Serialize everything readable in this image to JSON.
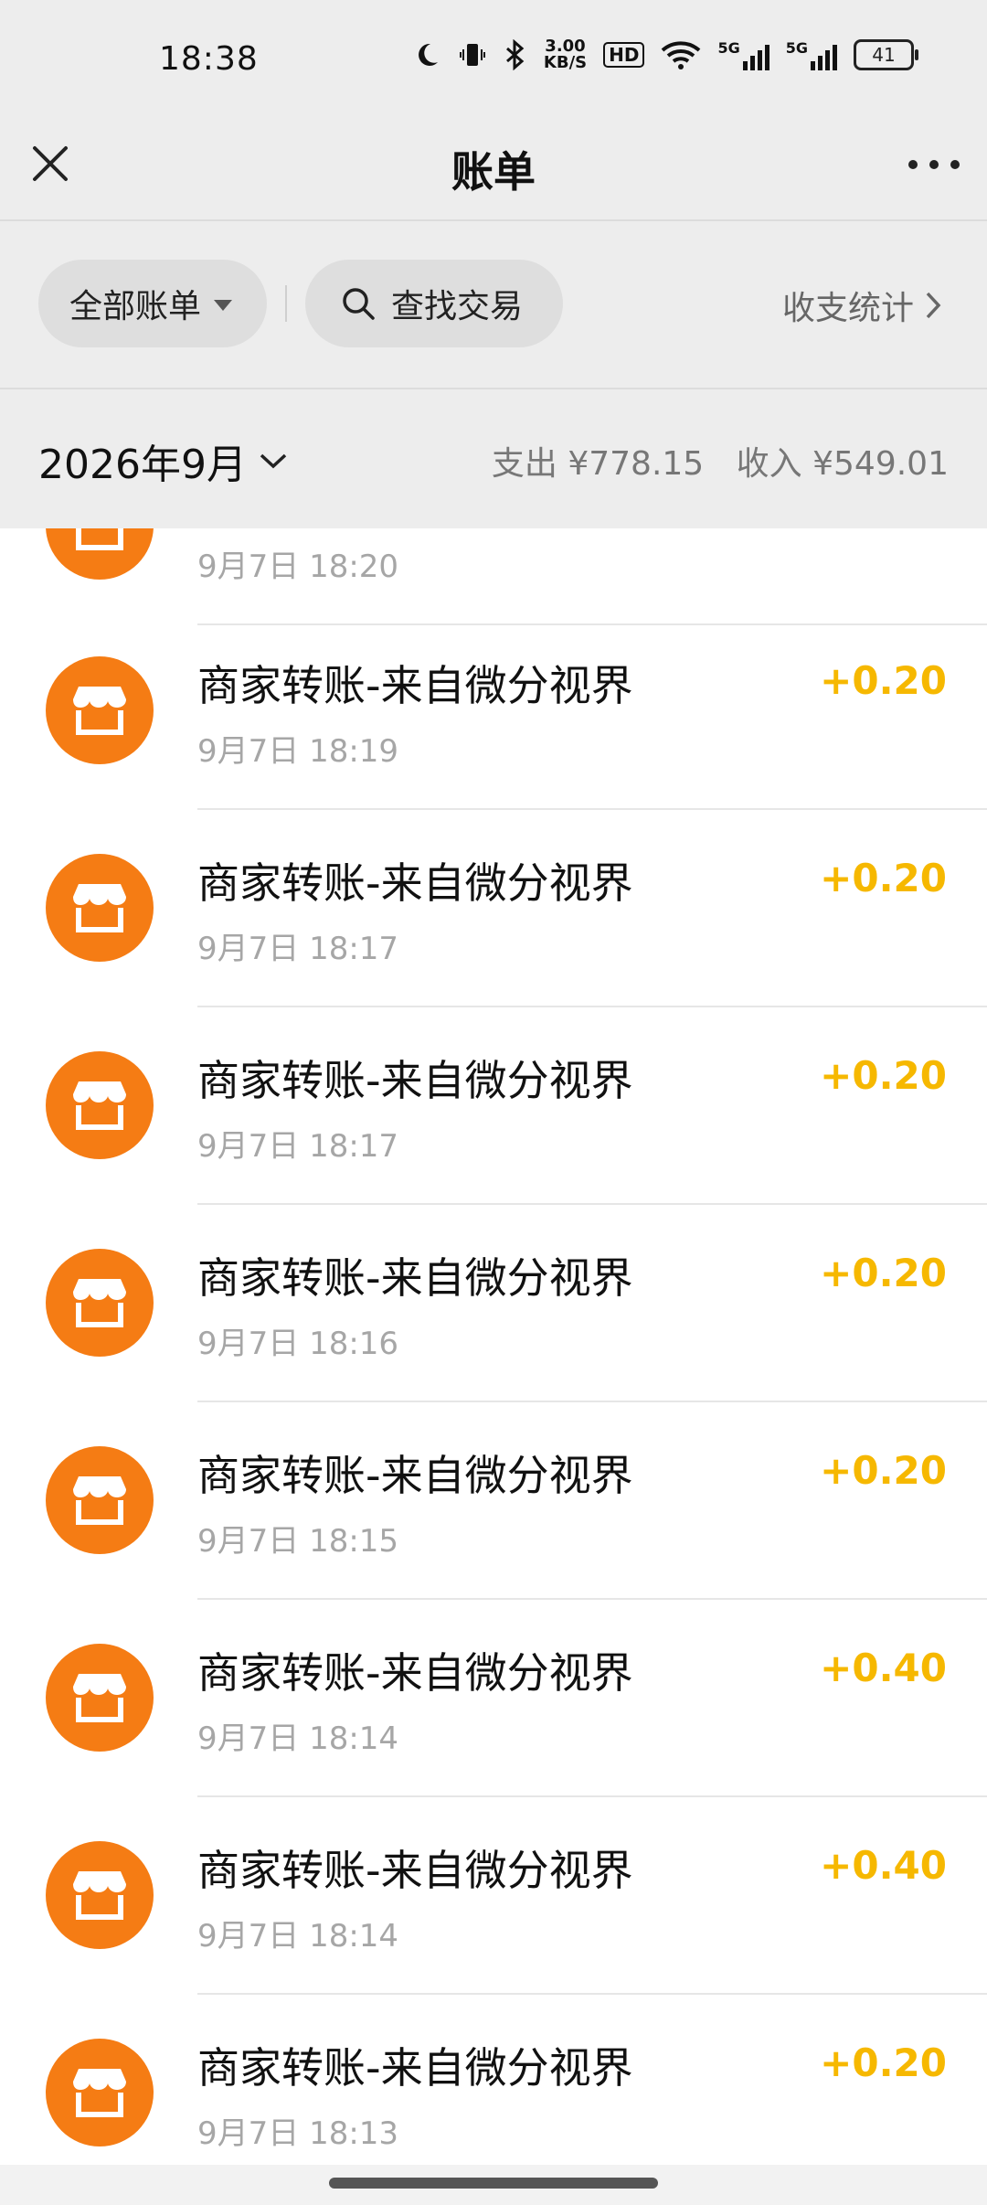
{
  "status_bar": {
    "time": "18:38",
    "net_speed_value": "3.00",
    "net_speed_unit": "KB/S",
    "hd": "HD",
    "sig1": "5G",
    "sig2": "5G",
    "battery": "41"
  },
  "header": {
    "title": "账单"
  },
  "filters": {
    "all_bills": "全部账单",
    "search": "查找交易",
    "stats": "收支统计"
  },
  "month": {
    "label": "2026年9月",
    "expense": "支出 ¥778.15",
    "income": "收入 ¥549.01"
  },
  "transactions": [
    {
      "title": "",
      "time": "9月7日 18:20",
      "amount": ""
    },
    {
      "title": "商家转账-来自微分视界",
      "time": "9月7日 18:19",
      "amount": "+0.20"
    },
    {
      "title": "商家转账-来自微分视界",
      "time": "9月7日 18:17",
      "amount": "+0.20"
    },
    {
      "title": "商家转账-来自微分视界",
      "time": "9月7日 18:17",
      "amount": "+0.20"
    },
    {
      "title": "商家转账-来自微分视界",
      "time": "9月7日 18:16",
      "amount": "+0.20"
    },
    {
      "title": "商家转账-来自微分视界",
      "time": "9月7日 18:15",
      "amount": "+0.20"
    },
    {
      "title": "商家转账-来自微分视界",
      "time": "9月7日 18:14",
      "amount": "+0.40"
    },
    {
      "title": "商家转账-来自微分视界",
      "time": "9月7日 18:14",
      "amount": "+0.40"
    },
    {
      "title": "商家转账-来自微分视界",
      "time": "9月7日 18:13",
      "amount": "+0.20"
    }
  ],
  "colors": {
    "accent_orange": "#f57c14",
    "amount_yellow": "#f6b800"
  },
  "icons": {
    "close": "close-icon",
    "more": "more-icon",
    "search": "search-icon",
    "chevron_right": "chevron-right-icon",
    "chevron_down": "chevron-down-icon",
    "merchant": "shop-icon"
  }
}
